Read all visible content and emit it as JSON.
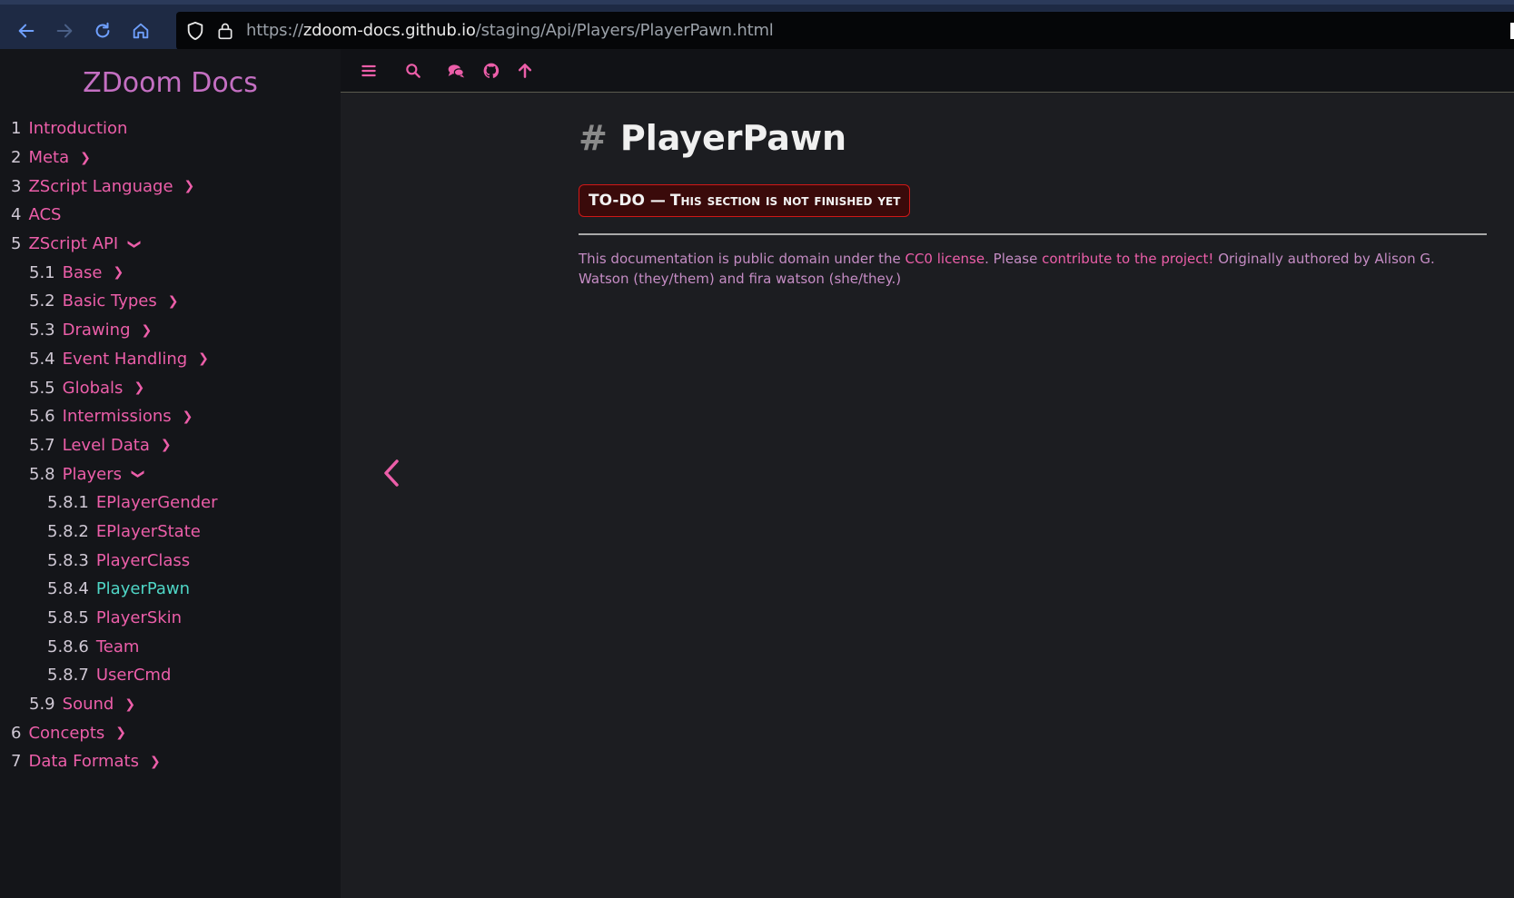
{
  "browser": {
    "url_prefix": "https://",
    "url_host": "zdoom-docs.github.io",
    "url_path": "/staging/Api/Players/PlayerPawn.html",
    "icons": [
      "back-arrow-icon",
      "forward-arrow-icon",
      "reload-icon",
      "home-icon",
      "shield-icon",
      "lock-icon"
    ]
  },
  "sidebar": {
    "title": "ZDoom Docs",
    "items": [
      {
        "num": "1",
        "label": "Introduction",
        "level": 1,
        "chevron": ""
      },
      {
        "num": "2",
        "label": "Meta",
        "level": 1,
        "chevron": "❯"
      },
      {
        "num": "3",
        "label": "ZScript Language",
        "level": 1,
        "chevron": "❯"
      },
      {
        "num": "4",
        "label": "ACS",
        "level": 1,
        "chevron": ""
      },
      {
        "num": "5",
        "label": "ZScript API",
        "level": 1,
        "chevron": "❯",
        "expanded": true
      },
      {
        "num": "5.1",
        "label": "Base",
        "level": 2,
        "chevron": "❯"
      },
      {
        "num": "5.2",
        "label": "Basic Types",
        "level": 2,
        "chevron": "❯"
      },
      {
        "num": "5.3",
        "label": "Drawing",
        "level": 2,
        "chevron": "❯"
      },
      {
        "num": "5.4",
        "label": "Event Handling",
        "level": 2,
        "chevron": "❯"
      },
      {
        "num": "5.5",
        "label": "Globals",
        "level": 2,
        "chevron": "❯"
      },
      {
        "num": "5.6",
        "label": "Intermissions",
        "level": 2,
        "chevron": "❯"
      },
      {
        "num": "5.7",
        "label": "Level Data",
        "level": 2,
        "chevron": "❯"
      },
      {
        "num": "5.8",
        "label": "Players",
        "level": 2,
        "chevron": "❯",
        "expanded": true
      },
      {
        "num": "5.8.1",
        "label": "EPlayerGender",
        "level": 3,
        "chevron": ""
      },
      {
        "num": "5.8.2",
        "label": "EPlayerState",
        "level": 3,
        "chevron": ""
      },
      {
        "num": "5.8.3",
        "label": "PlayerClass",
        "level": 3,
        "chevron": ""
      },
      {
        "num": "5.8.4",
        "label": "PlayerPawn",
        "level": 3,
        "chevron": "",
        "active": true
      },
      {
        "num": "5.8.5",
        "label": "PlayerSkin",
        "level": 3,
        "chevron": ""
      },
      {
        "num": "5.8.6",
        "label": "Team",
        "level": 3,
        "chevron": ""
      },
      {
        "num": "5.8.7",
        "label": "UserCmd",
        "level": 3,
        "chevron": ""
      },
      {
        "num": "5.9",
        "label": "Sound",
        "level": 2,
        "chevron": "❯"
      },
      {
        "num": "6",
        "label": "Concepts",
        "level": 1,
        "chevron": "❯"
      },
      {
        "num": "7",
        "label": "Data Formats",
        "level": 1,
        "chevron": "❯"
      }
    ]
  },
  "toolbar": {
    "icons": [
      "menu-icon",
      "search-icon",
      "comments-icon",
      "github-icon",
      "arrow-up-icon"
    ]
  },
  "content": {
    "hash": "#",
    "title": "PlayerPawn",
    "todo_lead": "TO-DO —",
    "todo_rest": "This section is not finished yet",
    "footer_1": "This documentation is public domain under the ",
    "footer_link_1": "CC0 license",
    "footer_2": ". Please ",
    "footer_link_2": "contribute to the project!",
    "footer_3": " Originally authored by Alison G. Watson (they/them) and fira watson (she/they.)"
  },
  "colors": {
    "accent": "#ec5ea9",
    "active": "#4fd6c6",
    "title": "#c46fc2",
    "todo_border": "#d01818",
    "background": "#1c1d21",
    "sidebar_bg": "#141519"
  }
}
